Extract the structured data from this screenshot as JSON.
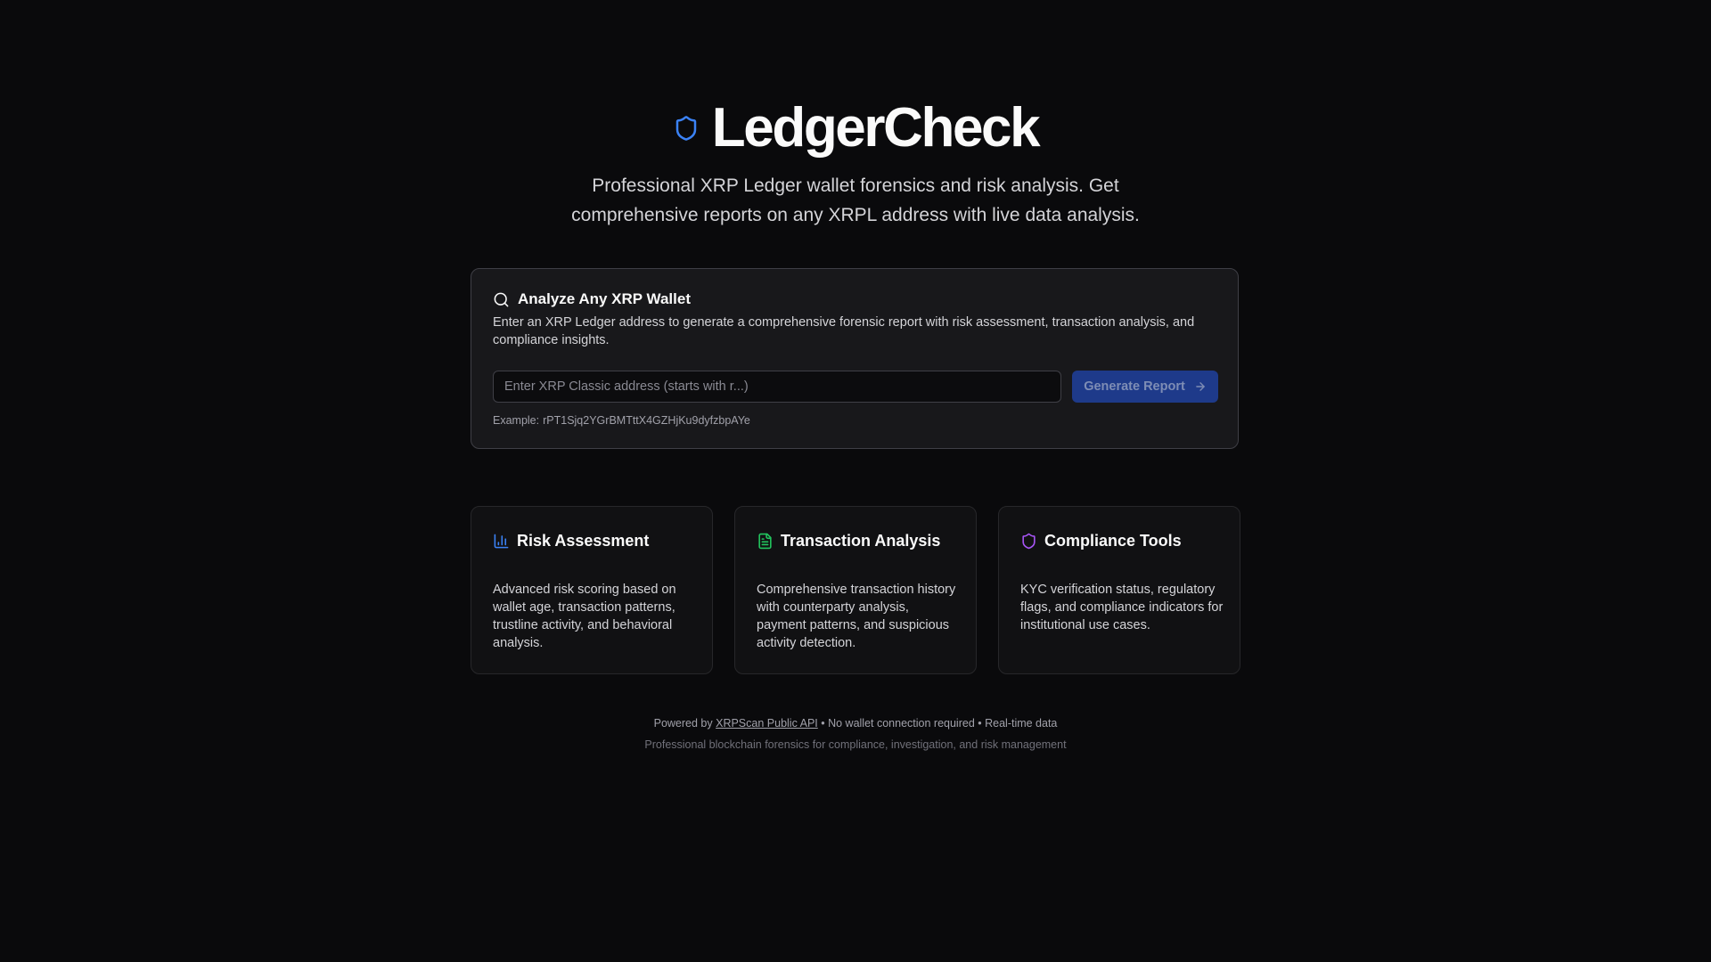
{
  "brand": {
    "title": "LedgerCheck",
    "logo_icon": "shield-icon",
    "accent": "#3b82f6"
  },
  "hero": {
    "tagline": "Professional XRP Ledger wallet forensics and risk analysis. Get comprehensive reports on any XRPL address with live data analysis."
  },
  "analyze": {
    "icon": "search-icon",
    "title": "Analyze Any XRP Wallet",
    "description": "Enter an XRP Ledger address to generate a comprehensive forensic report with risk assessment, transaction analysis, and compliance insights.",
    "input": {
      "value": "",
      "placeholder": "Enter XRP Classic address (starts with r...)"
    },
    "button": {
      "label": "Generate Report",
      "icon": "arrow-right-icon",
      "color": "#1e3a8a"
    },
    "example_label": "Example:",
    "example_address": "rPT1Sjq2YGrBMTttX4GZHjKu9dyfzbpAYe"
  },
  "features": [
    {
      "icon": "bar-chart-icon",
      "icon_color": "#3b82f6",
      "title": "Risk Assessment",
      "description": "Advanced risk scoring based on wallet age, transaction patterns, trustline activity, and behavioral analysis."
    },
    {
      "icon": "document-icon",
      "icon_color": "#22c55e",
      "title": "Transaction Analysis",
      "description": "Comprehensive transaction history with counterparty analysis, payment patterns, and suspicious activity detection."
    },
    {
      "icon": "shield-icon",
      "icon_color": "#a855f7",
      "title": "Compliance Tools",
      "description": "KYC verification status, regulatory flags, and compliance indicators for institutional use cases."
    }
  ],
  "footer": {
    "powered_prefix": "Powered by",
    "powered_link": "XRPScan Public API",
    "powered_suffix": "• No wallet connection required • Real-time data",
    "tagline": "Professional blockchain forensics for compliance, investigation, and risk management"
  }
}
